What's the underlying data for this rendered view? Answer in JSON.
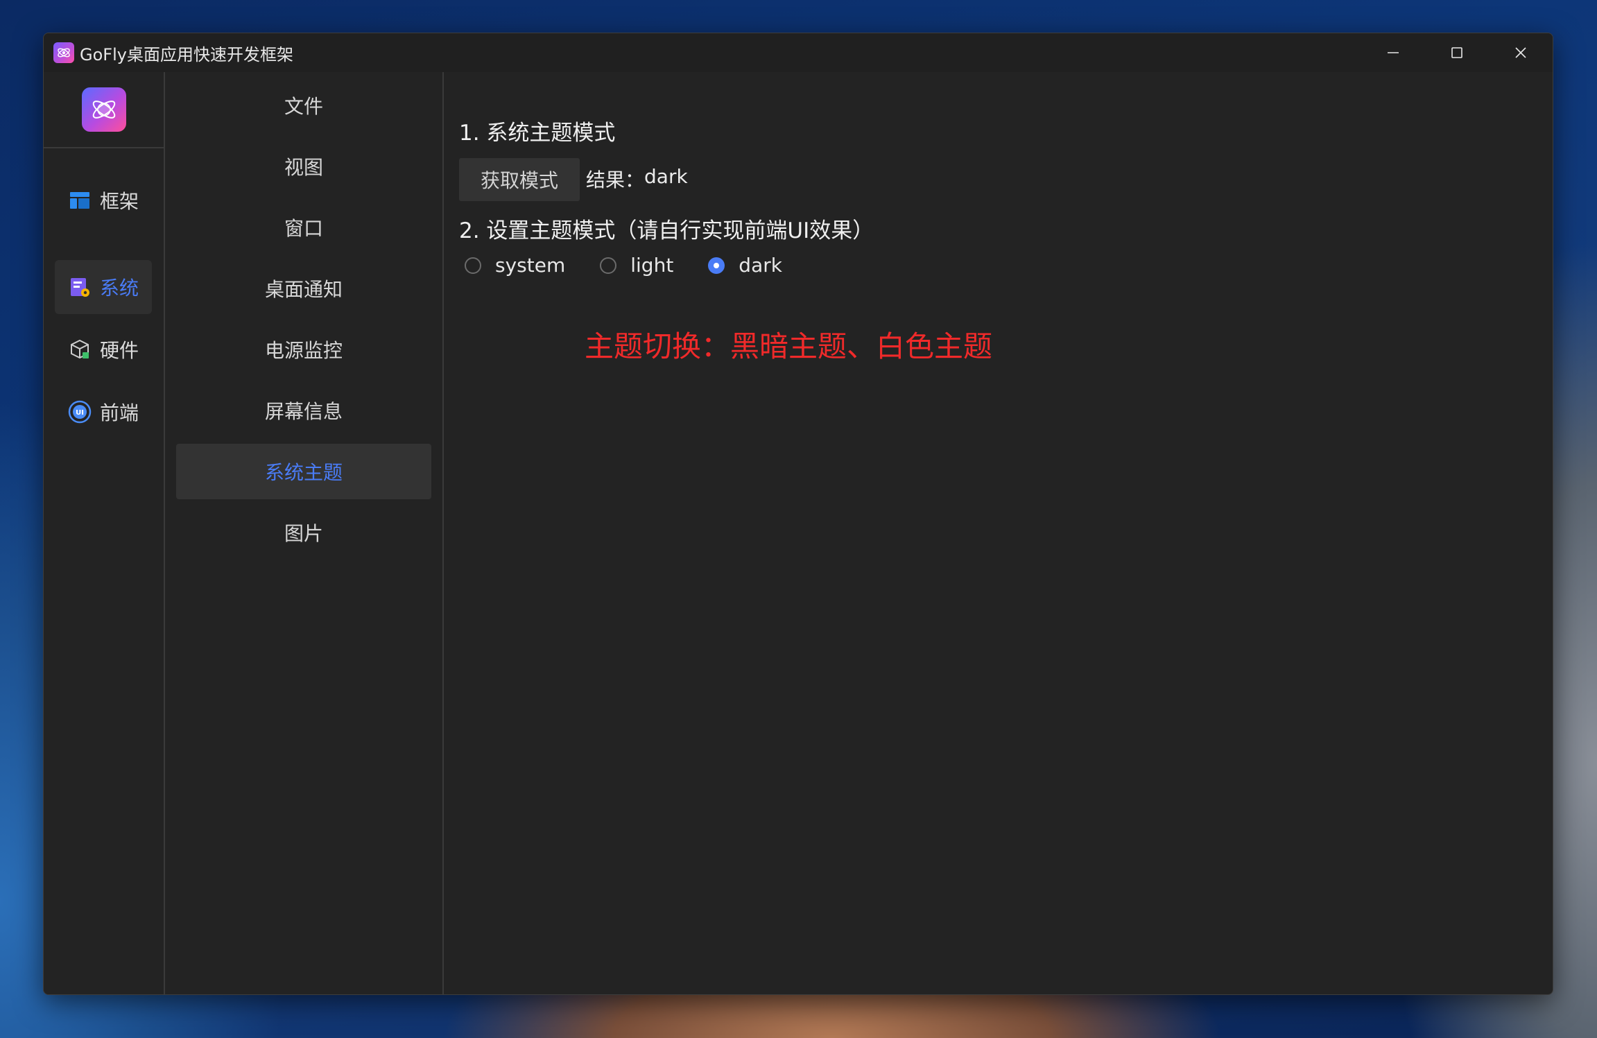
{
  "window": {
    "title": "GoFly桌面应用快速开发框架",
    "controls": [
      "minimize-icon",
      "maximize-icon",
      "close-icon"
    ]
  },
  "icon_rail": {
    "items": [
      {
        "label": "框架",
        "icon": "layout-icon",
        "active": false
      },
      {
        "label": "系统",
        "icon": "system-settings-icon",
        "active": true
      },
      {
        "label": "硬件",
        "icon": "hardware-box-icon",
        "active": false
      },
      {
        "label": "前端",
        "icon": "ui-badge-icon",
        "active": false
      }
    ]
  },
  "menu": {
    "items": [
      {
        "label": "文件",
        "active": false
      },
      {
        "label": "视图",
        "active": false
      },
      {
        "label": "窗口",
        "active": false
      },
      {
        "label": "桌面通知",
        "active": false
      },
      {
        "label": "电源监控",
        "active": false
      },
      {
        "label": "屏幕信息",
        "active": false
      },
      {
        "label": "系统主题",
        "active": true
      },
      {
        "label": "图片",
        "active": false
      }
    ]
  },
  "content": {
    "section1_title": "1. 系统主题模式",
    "get_mode_button": "获取模式",
    "result_label": "结果：",
    "result_value": "dark",
    "section2_title": "2. 设置主题模式（请自行实现前端UI效果）",
    "radio_options": [
      {
        "label": "system",
        "checked": false
      },
      {
        "label": "light",
        "checked": false
      },
      {
        "label": "dark",
        "checked": true
      }
    ],
    "annotation": "主题切换：黑暗主题、白色主题"
  },
  "colors": {
    "accent": "#4a7cf6",
    "annotation": "#f02a2a",
    "window_bg": "#232323"
  }
}
